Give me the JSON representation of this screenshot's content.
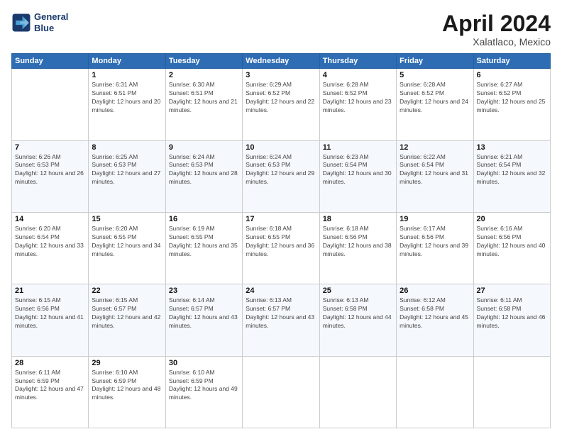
{
  "logo": {
    "line1": "General",
    "line2": "Blue"
  },
  "title": "April 2024",
  "subtitle": "Xalatlaco, Mexico",
  "headers": [
    "Sunday",
    "Monday",
    "Tuesday",
    "Wednesday",
    "Thursday",
    "Friday",
    "Saturday"
  ],
  "weeks": [
    [
      {
        "day": "",
        "sunrise": "",
        "sunset": "",
        "daylight": ""
      },
      {
        "day": "1",
        "sunrise": "6:31 AM",
        "sunset": "6:51 PM",
        "daylight": "12 hours and 20 minutes."
      },
      {
        "day": "2",
        "sunrise": "6:30 AM",
        "sunset": "6:51 PM",
        "daylight": "12 hours and 21 minutes."
      },
      {
        "day": "3",
        "sunrise": "6:29 AM",
        "sunset": "6:52 PM",
        "daylight": "12 hours and 22 minutes."
      },
      {
        "day": "4",
        "sunrise": "6:28 AM",
        "sunset": "6:52 PM",
        "daylight": "12 hours and 23 minutes."
      },
      {
        "day": "5",
        "sunrise": "6:28 AM",
        "sunset": "6:52 PM",
        "daylight": "12 hours and 24 minutes."
      },
      {
        "day": "6",
        "sunrise": "6:27 AM",
        "sunset": "6:52 PM",
        "daylight": "12 hours and 25 minutes."
      }
    ],
    [
      {
        "day": "7",
        "sunrise": "6:26 AM",
        "sunset": "6:53 PM",
        "daylight": "12 hours and 26 minutes."
      },
      {
        "day": "8",
        "sunrise": "6:25 AM",
        "sunset": "6:53 PM",
        "daylight": "12 hours and 27 minutes."
      },
      {
        "day": "9",
        "sunrise": "6:24 AM",
        "sunset": "6:53 PM",
        "daylight": "12 hours and 28 minutes."
      },
      {
        "day": "10",
        "sunrise": "6:24 AM",
        "sunset": "6:53 PM",
        "daylight": "12 hours and 29 minutes."
      },
      {
        "day": "11",
        "sunrise": "6:23 AM",
        "sunset": "6:54 PM",
        "daylight": "12 hours and 30 minutes."
      },
      {
        "day": "12",
        "sunrise": "6:22 AM",
        "sunset": "6:54 PM",
        "daylight": "12 hours and 31 minutes."
      },
      {
        "day": "13",
        "sunrise": "6:21 AM",
        "sunset": "6:54 PM",
        "daylight": "12 hours and 32 minutes."
      }
    ],
    [
      {
        "day": "14",
        "sunrise": "6:20 AM",
        "sunset": "6:54 PM",
        "daylight": "12 hours and 33 minutes."
      },
      {
        "day": "15",
        "sunrise": "6:20 AM",
        "sunset": "6:55 PM",
        "daylight": "12 hours and 34 minutes."
      },
      {
        "day": "16",
        "sunrise": "6:19 AM",
        "sunset": "6:55 PM",
        "daylight": "12 hours and 35 minutes."
      },
      {
        "day": "17",
        "sunrise": "6:18 AM",
        "sunset": "6:55 PM",
        "daylight": "12 hours and 36 minutes."
      },
      {
        "day": "18",
        "sunrise": "6:18 AM",
        "sunset": "6:56 PM",
        "daylight": "12 hours and 38 minutes."
      },
      {
        "day": "19",
        "sunrise": "6:17 AM",
        "sunset": "6:56 PM",
        "daylight": "12 hours and 39 minutes."
      },
      {
        "day": "20",
        "sunrise": "6:16 AM",
        "sunset": "6:56 PM",
        "daylight": "12 hours and 40 minutes."
      }
    ],
    [
      {
        "day": "21",
        "sunrise": "6:15 AM",
        "sunset": "6:56 PM",
        "daylight": "12 hours and 41 minutes."
      },
      {
        "day": "22",
        "sunrise": "6:15 AM",
        "sunset": "6:57 PM",
        "daylight": "12 hours and 42 minutes."
      },
      {
        "day": "23",
        "sunrise": "6:14 AM",
        "sunset": "6:57 PM",
        "daylight": "12 hours and 43 minutes."
      },
      {
        "day": "24",
        "sunrise": "6:13 AM",
        "sunset": "6:57 PM",
        "daylight": "12 hours and 43 minutes."
      },
      {
        "day": "25",
        "sunrise": "6:13 AM",
        "sunset": "6:58 PM",
        "daylight": "12 hours and 44 minutes."
      },
      {
        "day": "26",
        "sunrise": "6:12 AM",
        "sunset": "6:58 PM",
        "daylight": "12 hours and 45 minutes."
      },
      {
        "day": "27",
        "sunrise": "6:11 AM",
        "sunset": "6:58 PM",
        "daylight": "12 hours and 46 minutes."
      }
    ],
    [
      {
        "day": "28",
        "sunrise": "6:11 AM",
        "sunset": "6:59 PM",
        "daylight": "12 hours and 47 minutes."
      },
      {
        "day": "29",
        "sunrise": "6:10 AM",
        "sunset": "6:59 PM",
        "daylight": "12 hours and 48 minutes."
      },
      {
        "day": "30",
        "sunrise": "6:10 AM",
        "sunset": "6:59 PM",
        "daylight": "12 hours and 49 minutes."
      },
      {
        "day": "",
        "sunrise": "",
        "sunset": "",
        "daylight": ""
      },
      {
        "day": "",
        "sunrise": "",
        "sunset": "",
        "daylight": ""
      },
      {
        "day": "",
        "sunrise": "",
        "sunset": "",
        "daylight": ""
      },
      {
        "day": "",
        "sunrise": "",
        "sunset": "",
        "daylight": ""
      }
    ]
  ]
}
